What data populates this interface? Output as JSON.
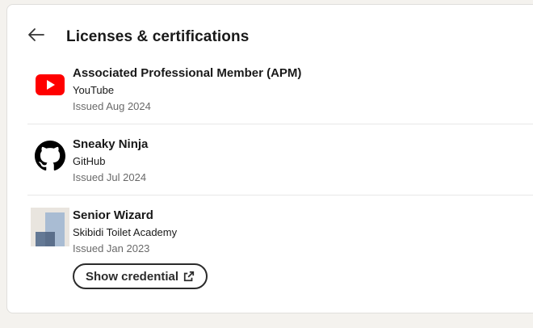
{
  "header": {
    "title": "Licenses & certifications",
    "back_icon": "arrow-left-icon"
  },
  "certifications": [
    {
      "name": "Associated Professional Member (APM)",
      "issuer": "YouTube",
      "issued": "Issued Aug 2024",
      "logo": "youtube-logo",
      "logo_color": "#ff0000"
    },
    {
      "name": "Sneaky Ninja",
      "issuer": "GitHub",
      "issued": "Issued Jul 2024",
      "logo": "github-logo",
      "logo_color": "#000000"
    },
    {
      "name": "Senior Wizard",
      "issuer": "Skibidi Toilet Academy",
      "issued": "Issued Jan 2023",
      "logo": "placeholder-company-logo",
      "logo_color": "#a9bcd3",
      "credential_button": "Show credential",
      "credential_icon": "external-link-icon"
    }
  ],
  "colors": {
    "page_background": "#f4f2ee",
    "card_background": "#ffffff",
    "divider": "#e8e8e8",
    "muted_text": "#666666"
  }
}
